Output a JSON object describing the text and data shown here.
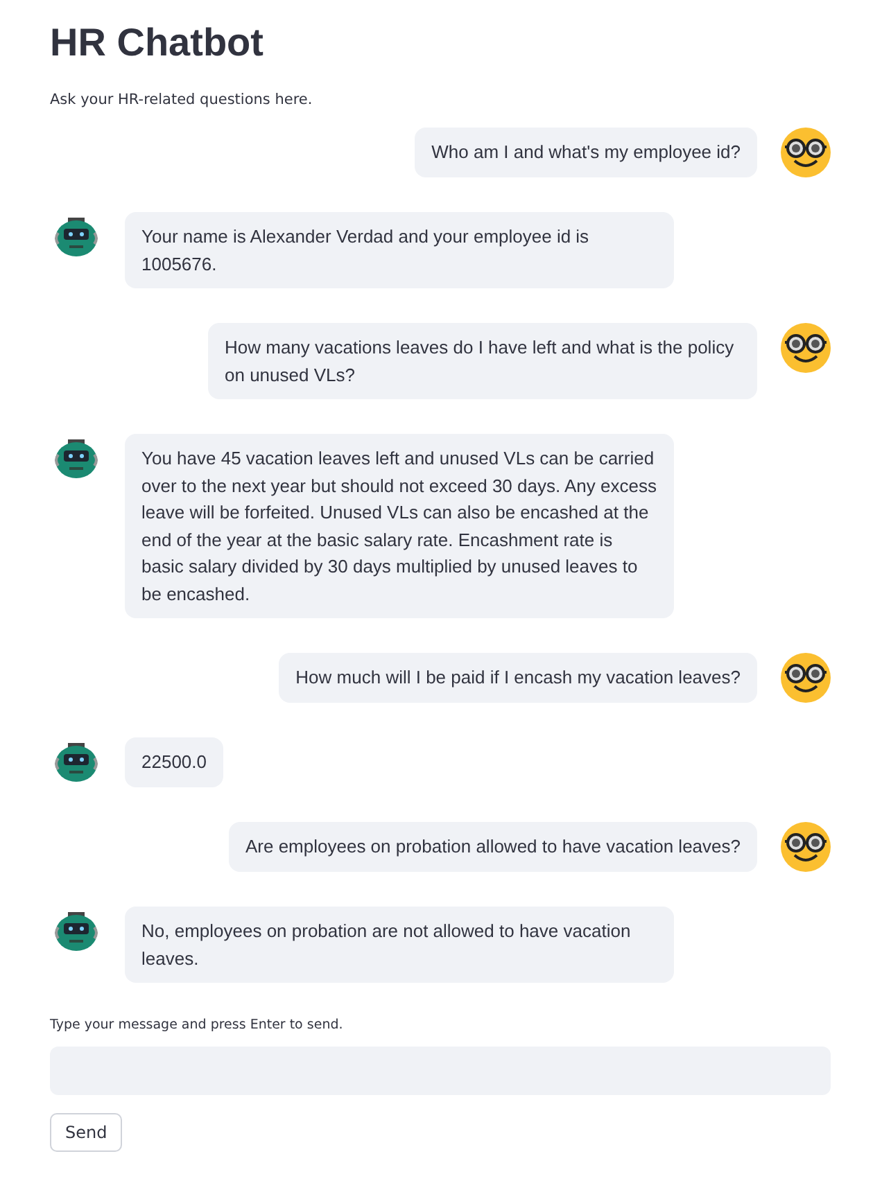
{
  "title": "HR Chatbot",
  "subtitle": "Ask your HR-related questions here.",
  "messages": [
    {
      "kind": "user",
      "text": "Who am I and what's my employee id?"
    },
    {
      "kind": "bot",
      "text": "Your name is Alexander Verdad and your employee id is 1005676."
    },
    {
      "kind": "user",
      "text": "How many vacations leaves do I have left and what is the policy on unused VLs?"
    },
    {
      "kind": "bot",
      "text": "You have 45 vacation leaves left and unused VLs can be carried over to the next year but should not exceed 30 days. Any excess leave will be forfeited. Unused VLs can also be encashed at the end of the year at the basic salary rate. Encashment rate is basic salary divided by 30 days multiplied by unused leaves to be encashed."
    },
    {
      "kind": "user",
      "text": "How much will I be paid if I encash my vacation leaves?"
    },
    {
      "kind": "bot",
      "text": "22500.0"
    },
    {
      "kind": "user",
      "text": "Are employees on probation allowed to have vacation leaves?"
    },
    {
      "kind": "bot",
      "text": "No, employees on probation are not allowed to have vacation leaves."
    }
  ],
  "input": {
    "label": "Type your message and press Enter to send."
  },
  "send_button": "Send"
}
